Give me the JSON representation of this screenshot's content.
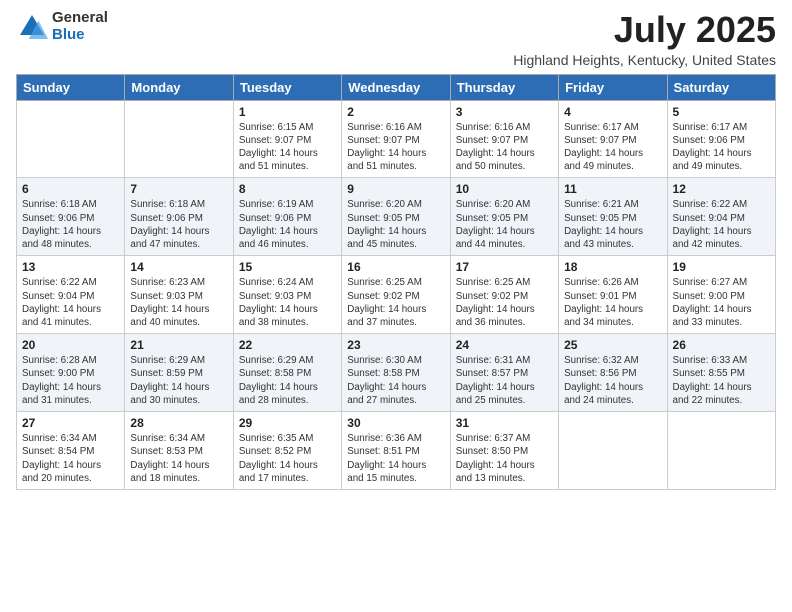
{
  "logo": {
    "general": "General",
    "blue": "Blue"
  },
  "title": "July 2025",
  "location": "Highland Heights, Kentucky, United States",
  "days_of_week": [
    "Sunday",
    "Monday",
    "Tuesday",
    "Wednesday",
    "Thursday",
    "Friday",
    "Saturday"
  ],
  "weeks": [
    [
      {
        "day": "",
        "info": ""
      },
      {
        "day": "",
        "info": ""
      },
      {
        "day": "1",
        "info": "Sunrise: 6:15 AM\nSunset: 9:07 PM\nDaylight: 14 hours and 51 minutes."
      },
      {
        "day": "2",
        "info": "Sunrise: 6:16 AM\nSunset: 9:07 PM\nDaylight: 14 hours and 51 minutes."
      },
      {
        "day": "3",
        "info": "Sunrise: 6:16 AM\nSunset: 9:07 PM\nDaylight: 14 hours and 50 minutes."
      },
      {
        "day": "4",
        "info": "Sunrise: 6:17 AM\nSunset: 9:07 PM\nDaylight: 14 hours and 49 minutes."
      },
      {
        "day": "5",
        "info": "Sunrise: 6:17 AM\nSunset: 9:06 PM\nDaylight: 14 hours and 49 minutes."
      }
    ],
    [
      {
        "day": "6",
        "info": "Sunrise: 6:18 AM\nSunset: 9:06 PM\nDaylight: 14 hours and 48 minutes."
      },
      {
        "day": "7",
        "info": "Sunrise: 6:18 AM\nSunset: 9:06 PM\nDaylight: 14 hours and 47 minutes."
      },
      {
        "day": "8",
        "info": "Sunrise: 6:19 AM\nSunset: 9:06 PM\nDaylight: 14 hours and 46 minutes."
      },
      {
        "day": "9",
        "info": "Sunrise: 6:20 AM\nSunset: 9:05 PM\nDaylight: 14 hours and 45 minutes."
      },
      {
        "day": "10",
        "info": "Sunrise: 6:20 AM\nSunset: 9:05 PM\nDaylight: 14 hours and 44 minutes."
      },
      {
        "day": "11",
        "info": "Sunrise: 6:21 AM\nSunset: 9:05 PM\nDaylight: 14 hours and 43 minutes."
      },
      {
        "day": "12",
        "info": "Sunrise: 6:22 AM\nSunset: 9:04 PM\nDaylight: 14 hours and 42 minutes."
      }
    ],
    [
      {
        "day": "13",
        "info": "Sunrise: 6:22 AM\nSunset: 9:04 PM\nDaylight: 14 hours and 41 minutes."
      },
      {
        "day": "14",
        "info": "Sunrise: 6:23 AM\nSunset: 9:03 PM\nDaylight: 14 hours and 40 minutes."
      },
      {
        "day": "15",
        "info": "Sunrise: 6:24 AM\nSunset: 9:03 PM\nDaylight: 14 hours and 38 minutes."
      },
      {
        "day": "16",
        "info": "Sunrise: 6:25 AM\nSunset: 9:02 PM\nDaylight: 14 hours and 37 minutes."
      },
      {
        "day": "17",
        "info": "Sunrise: 6:25 AM\nSunset: 9:02 PM\nDaylight: 14 hours and 36 minutes."
      },
      {
        "day": "18",
        "info": "Sunrise: 6:26 AM\nSunset: 9:01 PM\nDaylight: 14 hours and 34 minutes."
      },
      {
        "day": "19",
        "info": "Sunrise: 6:27 AM\nSunset: 9:00 PM\nDaylight: 14 hours and 33 minutes."
      }
    ],
    [
      {
        "day": "20",
        "info": "Sunrise: 6:28 AM\nSunset: 9:00 PM\nDaylight: 14 hours and 31 minutes."
      },
      {
        "day": "21",
        "info": "Sunrise: 6:29 AM\nSunset: 8:59 PM\nDaylight: 14 hours and 30 minutes."
      },
      {
        "day": "22",
        "info": "Sunrise: 6:29 AM\nSunset: 8:58 PM\nDaylight: 14 hours and 28 minutes."
      },
      {
        "day": "23",
        "info": "Sunrise: 6:30 AM\nSunset: 8:58 PM\nDaylight: 14 hours and 27 minutes."
      },
      {
        "day": "24",
        "info": "Sunrise: 6:31 AM\nSunset: 8:57 PM\nDaylight: 14 hours and 25 minutes."
      },
      {
        "day": "25",
        "info": "Sunrise: 6:32 AM\nSunset: 8:56 PM\nDaylight: 14 hours and 24 minutes."
      },
      {
        "day": "26",
        "info": "Sunrise: 6:33 AM\nSunset: 8:55 PM\nDaylight: 14 hours and 22 minutes."
      }
    ],
    [
      {
        "day": "27",
        "info": "Sunrise: 6:34 AM\nSunset: 8:54 PM\nDaylight: 14 hours and 20 minutes."
      },
      {
        "day": "28",
        "info": "Sunrise: 6:34 AM\nSunset: 8:53 PM\nDaylight: 14 hours and 18 minutes."
      },
      {
        "day": "29",
        "info": "Sunrise: 6:35 AM\nSunset: 8:52 PM\nDaylight: 14 hours and 17 minutes."
      },
      {
        "day": "30",
        "info": "Sunrise: 6:36 AM\nSunset: 8:51 PM\nDaylight: 14 hours and 15 minutes."
      },
      {
        "day": "31",
        "info": "Sunrise: 6:37 AM\nSunset: 8:50 PM\nDaylight: 14 hours and 13 minutes."
      },
      {
        "day": "",
        "info": ""
      },
      {
        "day": "",
        "info": ""
      }
    ]
  ]
}
